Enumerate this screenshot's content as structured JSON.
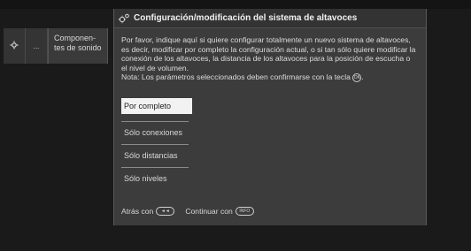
{
  "sidebar": {
    "gear_icon": "gear-icon",
    "dots": "...",
    "panel_label": "Componen-\ntes de sonido"
  },
  "dialog": {
    "title": "Configuración/modificación del sistema de altavoces",
    "title_icon": "gears-icon",
    "description": "Por favor, indique aquí si quiere configurar totalmente un nuevo sistema de altavoces, es decir, modificar por completo la configuración actual, o si tan sólo quiere modificar la conexión de los altavoces, la distancia de los altavoces para la posición de escucha o el nivel de volumen.",
    "note": "Nota: Los parámetros seleccionados deben confirmarse con la tecla",
    "note_end": ".",
    "note_key": "OK"
  },
  "menu": {
    "items": [
      {
        "label": "Por completo",
        "selected": true
      },
      {
        "label": "Sólo conexiones",
        "selected": false
      },
      {
        "label": "Sólo distancias",
        "selected": false
      },
      {
        "label": "Sólo niveles",
        "selected": false
      }
    ]
  },
  "footer": {
    "back_label": "Atrás con",
    "back_key": "◄◄",
    "continue_label": "Continuar con",
    "continue_key": "INFO"
  },
  "colors": {
    "background": "#1a1a1a",
    "dialog_bg": "#3c3c3c",
    "selected_bg": "#f2f2f2"
  }
}
